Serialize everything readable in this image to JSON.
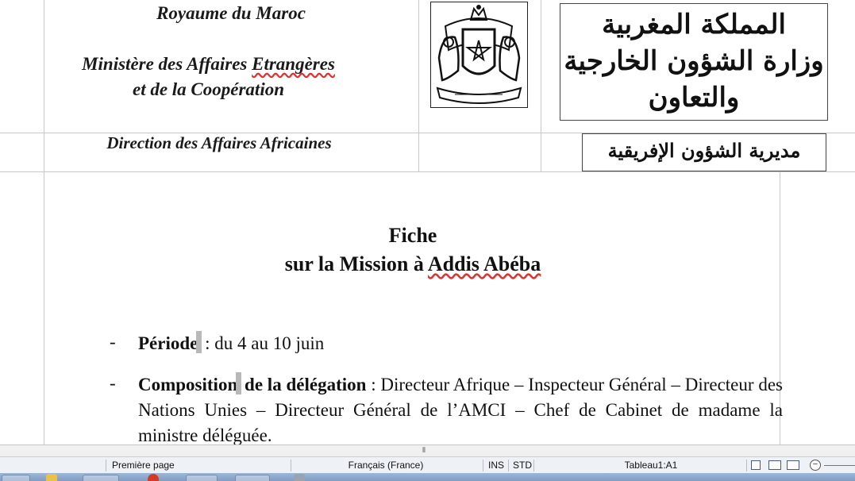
{
  "document": {
    "header_fr": {
      "royaume": "Royaume du Maroc",
      "ministere_line1": "Ministère des Affaires Etrangères",
      "ministere_line2": "et de la Coopération",
      "direction": "Direction  des Affaires Africaines"
    },
    "header_ar": {
      "line1": "المملكة المغربية",
      "line2": "وزارة الشؤون الخارجية",
      "line3": "والتعاون",
      "direction": "مديرية الشؤون الإفريقية"
    },
    "title_line1": "Fiche",
    "title_line2_prefix": "sur la Mission à ",
    "title_line2_city": "Addis Abéba",
    "bullets": [
      {
        "dash": "-",
        "label": "Période",
        "text": " : du 4 au 10 juin"
      },
      {
        "dash": "-",
        "label_a": "Composition",
        "label_b": " de la délégation",
        "text": " : Directeur Afrique – Inspecteur Général – Directeur des Nations Unies – Directeur Général de l’AMCI – Chef de Cabinet de madame la ministre déléguée."
      }
    ]
  },
  "statusbar": {
    "page": "Première page",
    "language": "Français (France)",
    "ins": "INS",
    "std": "STD",
    "cell": "Tableau1:A1",
    "zoom_minus": "−"
  },
  "scrollbar": {
    "grip": "⦀"
  },
  "icons": {
    "emblem": "moroccan-coat-of-arms",
    "view_single": "single-page-view-icon",
    "view_multi": "multi-page-view-icon",
    "view_book": "book-view-icon"
  },
  "colors": {
    "spellcheck": "#dd3333",
    "statusbar_bg": "#eef1f6",
    "taskbar": "#8aa7cd"
  }
}
